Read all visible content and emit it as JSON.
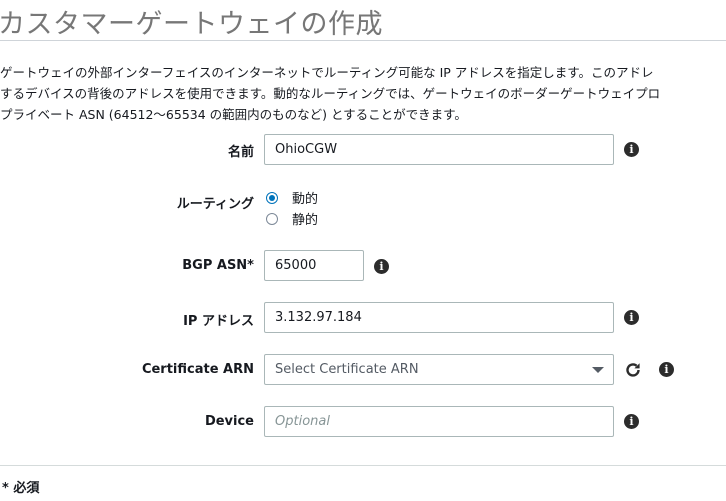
{
  "page": {
    "title": "カスタマーゲートウェイの作成",
    "description_lines": [
      "ゲートウェイの外部インターフェイスのインターネットでルーティング可能な IP アドレスを指定します。このアドレ",
      "するデバイスの背後のアドレスを使用できます。動的なルーティングでは、ゲートウェイのボーダーゲートウェイプロ",
      "プライベート ASN (64512〜65534 の範囲内のものなど) とすることができます。"
    ]
  },
  "form": {
    "name": {
      "label": "名前",
      "value": "OhioCGW",
      "info_icon": "info-icon"
    },
    "routing": {
      "label": "ルーティング",
      "options": [
        {
          "label": "動的",
          "selected": true
        },
        {
          "label": "静的",
          "selected": false
        }
      ]
    },
    "bgp_asn": {
      "label": "BGP ASN*",
      "value": "65000",
      "info_icon": "info-icon"
    },
    "ip_address": {
      "label": "IP アドレス",
      "value": "3.132.97.184",
      "info_icon": "info-icon"
    },
    "certificate_arn": {
      "label": "Certificate ARN",
      "placeholder": "Select Certificate ARN",
      "refresh_icon": "refresh-icon",
      "info_icon": "info-icon"
    },
    "device": {
      "label": "Device",
      "placeholder": "Optional",
      "info_icon": "info-icon"
    }
  },
  "footer": {
    "required_note": "* 必須"
  },
  "colors": {
    "accent": "#0073bb",
    "border": "#aab7b8",
    "title": "#777777"
  }
}
